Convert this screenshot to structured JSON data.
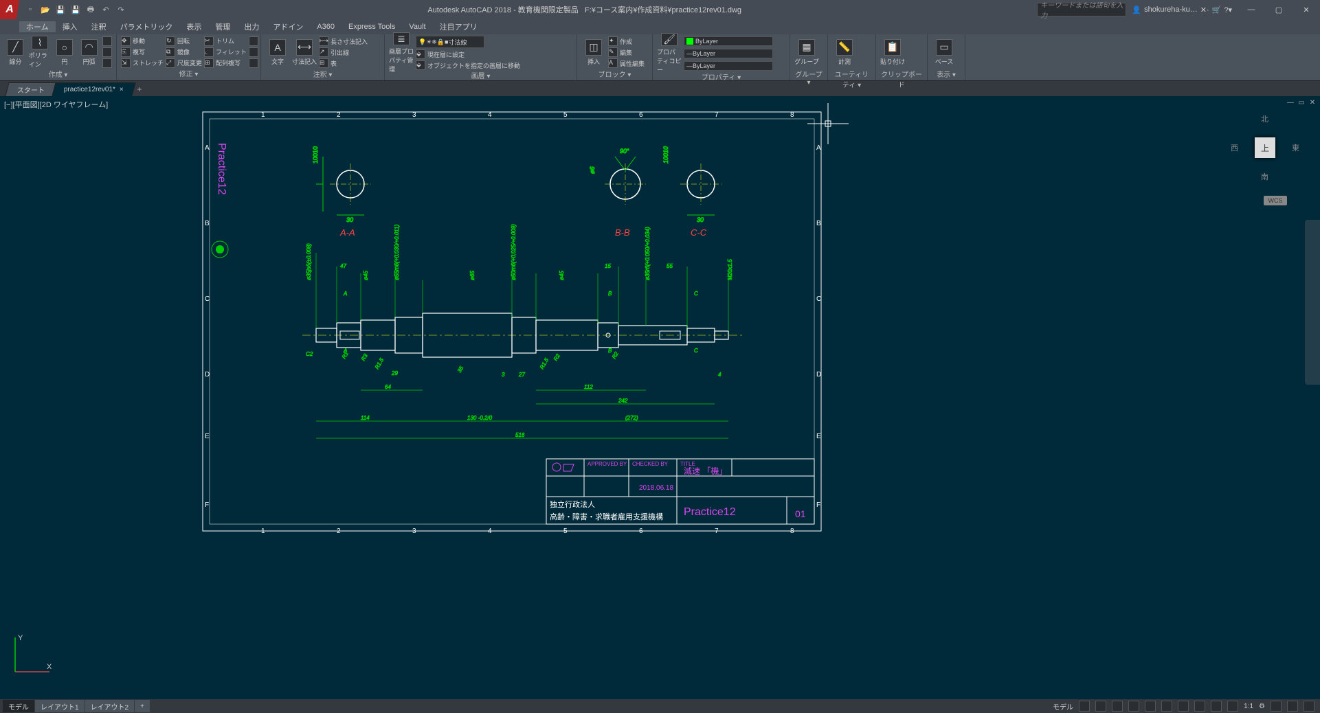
{
  "app": {
    "title": "Autodesk AutoCAD 2018 - 教育機関限定製品",
    "filepath": "F:¥コース案内¥作成資料¥practice12rev01.dwg",
    "search_placeholder": "キーワードまたは語句を入力",
    "user": "shokureha-ku…",
    "logo": "A"
  },
  "menus": [
    "ホーム",
    "挿入",
    "注釈",
    "パラメトリック",
    "表示",
    "管理",
    "出力",
    "アドイン",
    "A360",
    "Express Tools",
    "Vault",
    "注目アプリ"
  ],
  "ribbon": {
    "draw": {
      "title": "作成 ▾",
      "line": "線分",
      "polyline": "ポリライン",
      "circle": "円",
      "arc": "円弧"
    },
    "modify": {
      "title": "修正 ▾",
      "move": "移動",
      "copy": "複写",
      "stretch": "ストレッチ",
      "rotate": "回転",
      "mirror": "鏡像",
      "scale": "尺度変更",
      "trim": "トリム",
      "fillet": "フィレット",
      "array": "配列複写"
    },
    "annot": {
      "title": "注釈 ▾",
      "text": "文字",
      "dim": "寸法記入",
      "ldim": "長さ寸法記入",
      "leader": "引出線",
      "table": "表"
    },
    "layer": {
      "title": "画層 ▾",
      "mgr": "画層プロパティ管理",
      "current": "寸法線",
      "setcur": "現在層に設定",
      "moveto": "オブジェクトを指定の画層に移動"
    },
    "block": {
      "title": "ブロック ▾",
      "insert": "挿入",
      "create": "作成",
      "edit": "編集",
      "attr": "属性編集"
    },
    "prop": {
      "title": "プロパティ ▾",
      "props": "プロパティコピー",
      "bylayer": "ByLayer"
    },
    "group": {
      "title": "グループ ▾",
      "grp": "グループ"
    },
    "util": {
      "title": "ユーティリティ ▾",
      "measure": "計測"
    },
    "clip": {
      "title": "クリップボード",
      "paste": "貼り付け"
    },
    "view": {
      "title": "表示 ▾",
      "base": "ベース"
    }
  },
  "doctabs": {
    "start": "スタート",
    "file": "practice12rev01*",
    "dirty": "×"
  },
  "viewport": {
    "label": "[−][平面図][2D ワイヤフレーム]",
    "cube_top": "上",
    "north": "北",
    "south": "南",
    "east": "東",
    "west": "西",
    "wcs": "WCS"
  },
  "drawing": {
    "title_side": "Practice12",
    "sections": {
      "aa": "A-A",
      "bb": "B-B",
      "cc": "C-C"
    },
    "dims": {
      "d10010a": "10010",
      "d30a": "30",
      "d90": "90°",
      "d6": "ø6",
      "d10010b": "10010",
      "d30b": "30",
      "d35js6": "ø35js6(±0.008)",
      "d47": "47",
      "d45a": "ø45",
      "d55m6": "ø55m6(+0.030/+0.011)",
      "d65": "ø65",
      "d50m6": "ø50m6(+0.025/+0.009)",
      "d45b": "ø45",
      "d15": "15",
      "d35r6": "ø35r6(+0.050/+0.034)",
      "d55": "55",
      "m20": "M20x1.5",
      "c2": "C2",
      "r1": "R1",
      "r3": "R3",
      "r15a": "R1.5",
      "d29": "29",
      "d35": "35",
      "d3": "3",
      "d27": "27",
      "r15b": "R1.5",
      "r2": "R2",
      "r2b": "R2",
      "d4": "4",
      "d64": "64",
      "d112": "112",
      "d242": "242",
      "d114": "114",
      "d130": "130 -0.2/0",
      "d272": "(272)",
      "d516": "516",
      "sec_a": "A",
      "sec_b": "B",
      "sec_c": "C"
    },
    "titleblock": {
      "org1": "独立行政法人",
      "org2": "高齢・障害・求職者雇用支援機構",
      "name": "Practice12",
      "date": "2018.06.18",
      "num": "01",
      "approved": "APPROVED BY",
      "checked": "CHECKED BY",
      "title_lbl": "TITLE",
      "reducer": "減速 「機」"
    }
  },
  "layouts": {
    "model": "モデル",
    "l1": "レイアウト1",
    "l2": "レイアウト2"
  },
  "status": {
    "model": "モデル",
    "scale": "1:1",
    "gear": "⚙"
  }
}
